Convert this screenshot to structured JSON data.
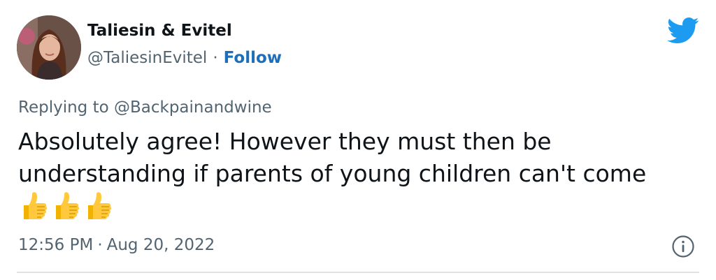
{
  "author": {
    "display_name": "Taliesin & Evitel",
    "handle": "@TaliesinEvitel",
    "separator": "·",
    "follow_label": "Follow"
  },
  "reply": {
    "prefix": "Replying to",
    "target": "@Backpainandwine"
  },
  "tweet": {
    "text": "Absolutely agree! However they must then be understanding if parents of young children can't come",
    "emojis": [
      "thumbs-up",
      "thumbs-up",
      "thumbs-up"
    ]
  },
  "meta": {
    "time": "12:56 PM",
    "separator": "·",
    "date": "Aug 20, 2022"
  },
  "colors": {
    "text": "#0f1419",
    "secondary": "#536471",
    "link": "#1d6fbb",
    "brand": "#1d9bf0",
    "divider": "#dfe3e6"
  },
  "icons": {
    "brand": "twitter-bird-icon",
    "info": "info-icon",
    "emoji": "thumbs-up-icon"
  }
}
